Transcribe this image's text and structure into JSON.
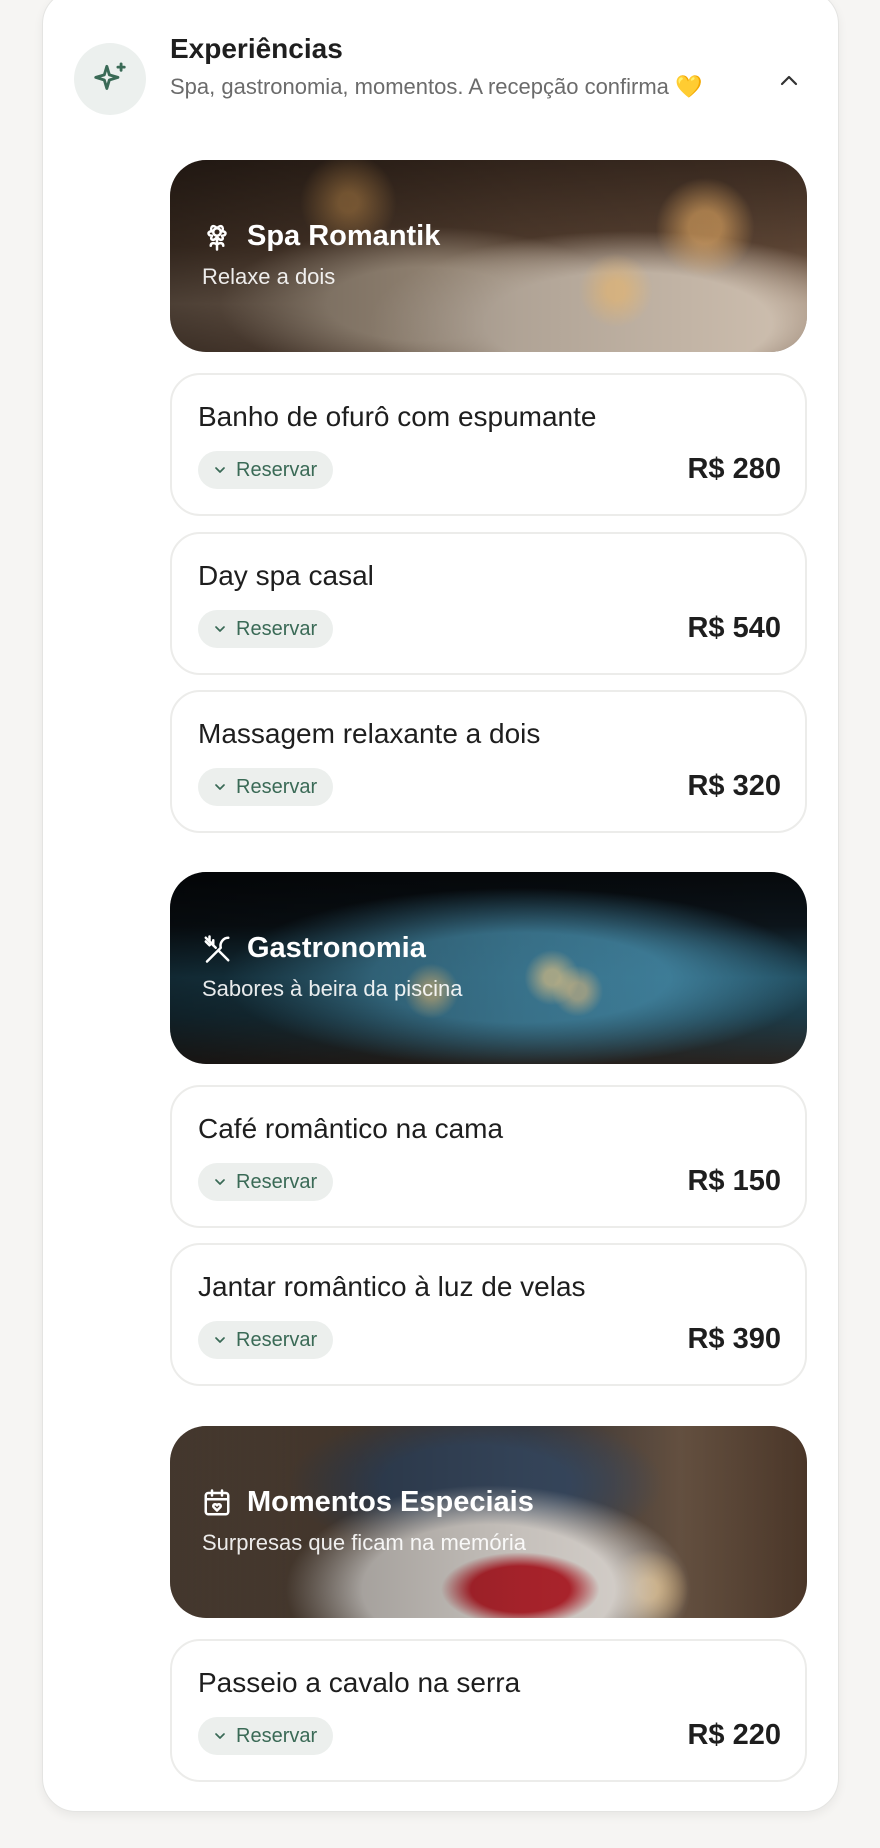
{
  "header": {
    "title": "Experiências",
    "subtitle": "Spa, gastronomia, momentos. A recepção confirma 💛",
    "icon": "sparkles-icon",
    "toggle_icon": "chevron-up-icon"
  },
  "colors": {
    "accent": "#3a6a56",
    "pill_bg": "#ecefed",
    "card_border": "#ececea"
  },
  "categories": [
    {
      "title": "Spa Romantik",
      "subtitle": "Relaxe a dois",
      "icon": "flower-icon",
      "items": [
        {
          "name": "Banho de ofurô com espumante",
          "action": "Reservar",
          "price": "R$ 280"
        },
        {
          "name": "Day spa casal",
          "action": "Reservar",
          "price": "R$ 540"
        },
        {
          "name": "Massagem relaxante a dois",
          "action": "Reservar",
          "price": "R$ 320"
        }
      ]
    },
    {
      "title": "Gastronomia",
      "subtitle": "Sabores à beira da piscina",
      "icon": "utensils-crossed-icon",
      "items": [
        {
          "name": "Café romântico na cama",
          "action": "Reservar",
          "price": "R$ 150"
        },
        {
          "name": "Jantar romântico à luz de velas",
          "action": "Reservar",
          "price": "R$ 390"
        }
      ]
    },
    {
      "title": "Momentos Especiais",
      "subtitle": "Surpresas que ficam na memória",
      "icon": "calendar-heart-icon",
      "items": [
        {
          "name": "Passeio a cavalo na serra",
          "action": "Reservar",
          "price": "R$ 220"
        }
      ]
    }
  ]
}
